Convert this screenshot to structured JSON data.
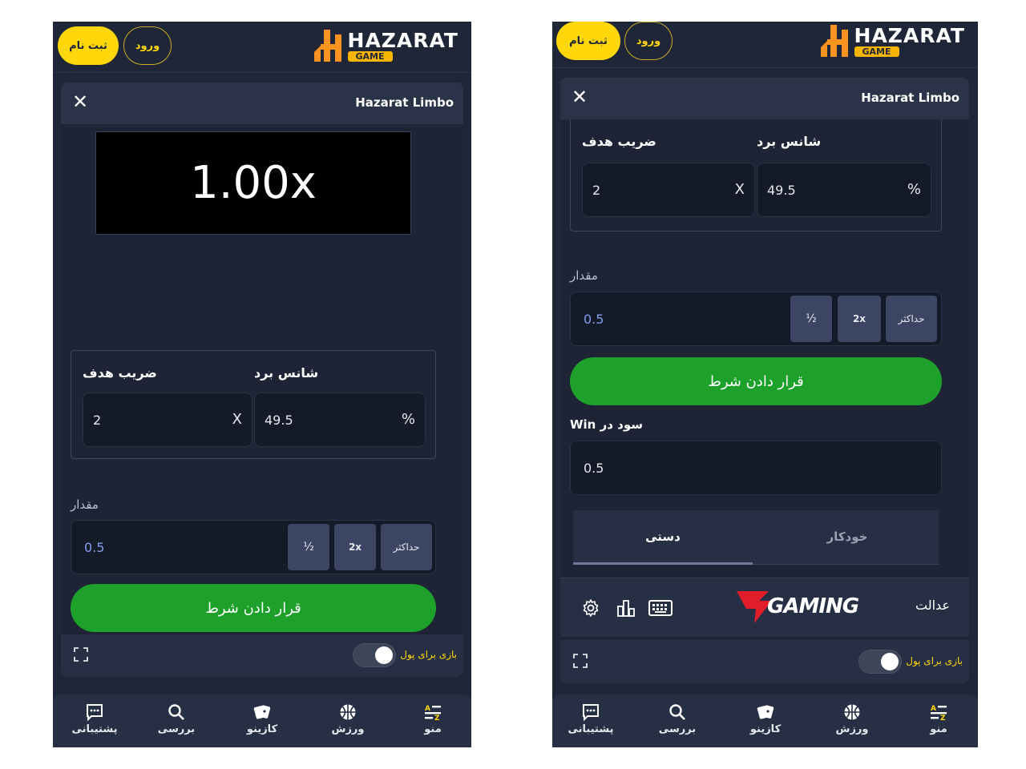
{
  "header": {
    "brand": "HAZARAT",
    "brand_sub": "GAME",
    "signup_label": "ثبت نام",
    "login_label": "ورود"
  },
  "modal": {
    "title": "Hazarat Limbo",
    "close_icon": "close-icon"
  },
  "game": {
    "multiplier_display": "1.00x",
    "target_label": "ضریب هدف",
    "target_value": "2",
    "target_unit": "X",
    "chance_label": "شانس برد",
    "chance_value": "49.5",
    "chance_unit": "%",
    "amount_label": "مقدار",
    "amount_value": "0.5",
    "half_label": "½",
    "double_label": "2x",
    "max_label": "حداکثر",
    "bet_label": "قرار دادن شرط",
    "profit_label": "Win سود در",
    "profit_value": "0.5",
    "tab_manual": "دستی",
    "tab_auto": "خودکار",
    "fairness_label": "عدالت",
    "provider_logo": "GAMING"
  },
  "footer": {
    "real_money_label": "بازی برای پول"
  },
  "nav": {
    "menu": "منو",
    "sports": "ورزش",
    "casino": "کازینو",
    "search": "بررسی",
    "support": "پشتیبانی"
  },
  "colors": {
    "accent_yellow": "#ffd70a",
    "bet_green": "#1ea12b",
    "bg": "#1f2637"
  }
}
